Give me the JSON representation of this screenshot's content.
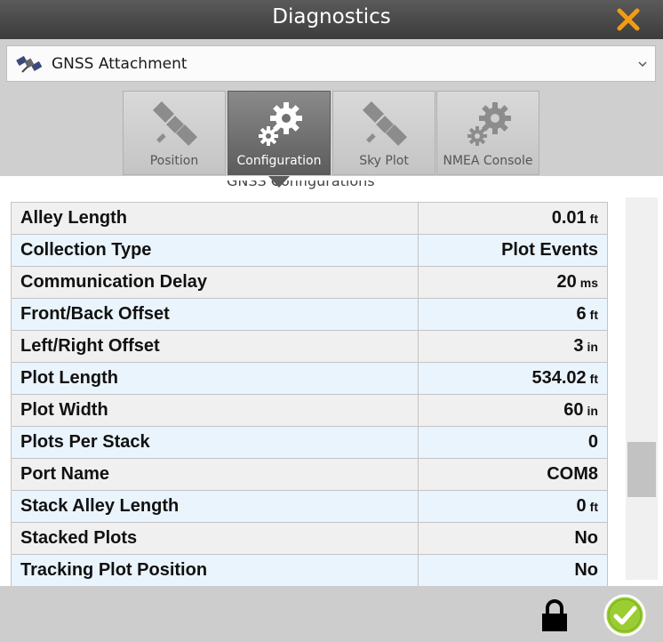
{
  "window": {
    "title": "Diagnostics",
    "close_icon": "close-icon",
    "accent_color": "#f39c12"
  },
  "device_select": {
    "selected": "GNSS Attachment",
    "icon": "satellite-icon"
  },
  "tabs": [
    {
      "label": "Position",
      "icon": "satellite-icon",
      "active": false
    },
    {
      "label": "Configuration",
      "icon": "gears-icon",
      "active": true
    },
    {
      "label": "Sky Plot",
      "icon": "satellite-icon",
      "active": false
    },
    {
      "label": "NMEA Console",
      "icon": "gears-icon",
      "active": false
    }
  ],
  "section_title": "GNSS Configurations",
  "properties": [
    {
      "name": "Alley Length",
      "value": "0.01",
      "unit": "ft"
    },
    {
      "name": "Collection Type",
      "value": "Plot Events",
      "unit": ""
    },
    {
      "name": "Communication Delay",
      "value": "20",
      "unit": "ms"
    },
    {
      "name": "Front/Back Offset",
      "value": "6",
      "unit": "ft"
    },
    {
      "name": "Left/Right Offset",
      "value": "3",
      "unit": "in"
    },
    {
      "name": "Plot Length",
      "value": "534.02",
      "unit": "ft"
    },
    {
      "name": "Plot Width",
      "value": "60",
      "unit": "in"
    },
    {
      "name": "Plots Per Stack",
      "value": "0",
      "unit": ""
    },
    {
      "name": "Port Name",
      "value": "COM8",
      "unit": ""
    },
    {
      "name": "Stack Alley Length",
      "value": "0",
      "unit": "ft"
    },
    {
      "name": "Stacked Plots",
      "value": "No",
      "unit": ""
    },
    {
      "name": "Tracking Plot Position",
      "value": "No",
      "unit": ""
    }
  ],
  "scroll_position": 0.6,
  "footer": {
    "lock_icon": "lock-icon",
    "confirm_icon": "check-circle-icon",
    "confirm_color": "#9acd32"
  }
}
